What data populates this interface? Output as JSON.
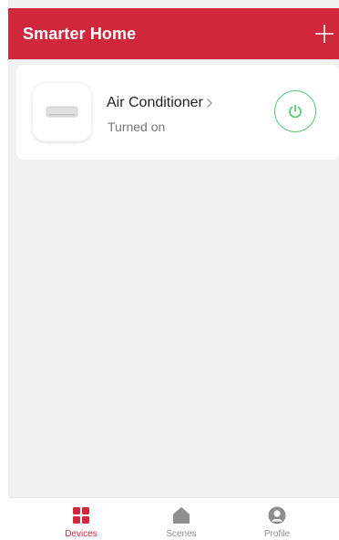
{
  "header": {
    "title": "Smarter Home",
    "add_icon": "plus-icon"
  },
  "devices": [
    {
      "name": "Air Conditioner",
      "status": "Turned on",
      "icon": "air-conditioner-icon",
      "power_on": true
    }
  ],
  "tabs": [
    {
      "label": "Devices",
      "icon": "grid-icon",
      "active": true
    },
    {
      "label": "Scenes",
      "icon": "home-icon",
      "active": false
    },
    {
      "label": "Profile",
      "icon": "user-icon",
      "active": false
    }
  ],
  "colors": {
    "brand": "#d1273d",
    "power_on": "#59c97a",
    "background": "#f1f1f1",
    "inactive": "#8e8e8e"
  }
}
